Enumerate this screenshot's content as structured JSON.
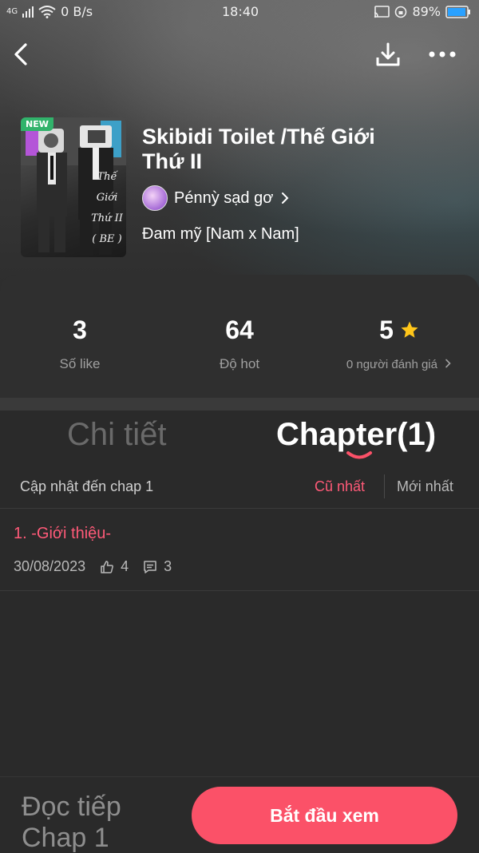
{
  "status_bar": {
    "network": "4G",
    "speed": "0 B/s",
    "time": "18:40",
    "battery": "89%"
  },
  "header": {
    "back_icon": "back-arrow-icon",
    "download_icon": "download-icon",
    "more_icon": "more-dots-icon"
  },
  "book": {
    "badge": "NEW",
    "cover_text": [
      "Thế",
      "Giới",
      "Thứ II",
      "( BE )"
    ],
    "title": "Skibidi Toilet /Thế Giới Thứ II",
    "author": "Pénnỳ sạd gơ",
    "genre": "Đam mỹ [Nam x Nam]"
  },
  "stats": {
    "likes": {
      "value": "3",
      "label": "Số like"
    },
    "hot": {
      "value": "64",
      "label": "Độ hot"
    },
    "rating": {
      "value": "5",
      "label": "0 người đánh giá"
    }
  },
  "tabs": {
    "detail": "Chi tiết",
    "chapter": "Chapter(1)"
  },
  "sort_bar": {
    "update_text": "Cập nhật đến chap 1",
    "oldest": "Cũ nhất",
    "newest": "Mới nhất"
  },
  "chapters": [
    {
      "title": "1. -Giới thiệu-",
      "date": "30/08/2023",
      "likes": "4",
      "comments": "3"
    }
  ],
  "bottom": {
    "continue_text": "Đọc tiếp Chap 1",
    "start_button": "Bắt đầu xem"
  },
  "colors": {
    "accent": "#fb5168",
    "accent_text": "#ff5a78",
    "star": "#ffc61a",
    "background": "#2a2a2a"
  }
}
